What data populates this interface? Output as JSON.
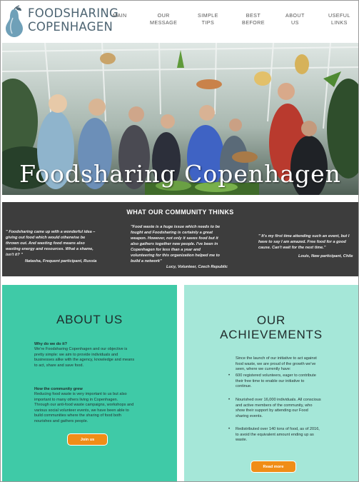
{
  "logo": {
    "line1": "FOODSHARING",
    "line2": "COPENHAGEN"
  },
  "nav": {
    "main": "MAIN",
    "our_message_1": "OUR",
    "our_message_2": "MESSAGE",
    "simple_tips_1": "SIMPLE",
    "simple_tips_2": "TIPS",
    "best_before_1": "BEST",
    "best_before_2": "BEFORE",
    "about_us_1": "ABOUT",
    "about_us_2": "US",
    "useful_links_1": "USEFUL",
    "useful_links_2": "LINKS"
  },
  "hero": {
    "title": "Foodsharing Copenhagen"
  },
  "community": {
    "title": "WHAT OUR COMMUNITY THINKS",
    "quotes": [
      {
        "lines": [
          "\" Foodsharing came up with a wonderful idea –",
          "giving out food which would otherwise be",
          "thrown out. And wasting food means also",
          "wasting energy and resources. What a shame,",
          "isn't it? \""
        ],
        "author": "Natasha, Frequent participant, Russia"
      },
      {
        "lines": [
          "\"Food waste is a huge issue which needs to be",
          "fought and Foodsharing is certainly a great",
          "weapon. However, not only it saves food but it",
          "also gathers together new people. I've been in",
          "Copenhagen for less than a year and",
          "volunteering for this organization helped me to",
          "build a network\""
        ],
        "author": "Lucy, Volunteer, Czech Republic"
      },
      {
        "lines": [
          "\" It's my first time attending such an event, but I",
          "have to say I am amazed. Free food for a good",
          "cause. Can't wait for the next time.\""
        ],
        "author": "Louis, New participant, Chile"
      }
    ]
  },
  "about": {
    "heading": "ABOUT US",
    "why_head": "Why do we do it?",
    "why_lines": [
      "We're Foodsharing Copenhagen and our objective is",
      "pretty simple: we aim to provide individuals and",
      "businesses alike with the agency, knowledge and means",
      "to act, share and save food."
    ],
    "grew_head": "How the community grew",
    "grew_lines": [
      "Reducing food waste is very important to us but also",
      "important to many others living in Copenhagen.",
      "Through our anti-food waste campaigns, workshops and",
      "various social volunteer events, we have been able to",
      "build communities where the sharing of food both",
      "nourishes and gathers people."
    ],
    "button": "Join us"
  },
  "achievements": {
    "heading_1": "OUR",
    "heading_2": "ACHIEVEMENTS",
    "intro_lines": [
      "Since the launch of our initiative to act against",
      "food waste, we are proud of the growth we've",
      "seen, where we currently have:"
    ],
    "bullets": [
      [
        "600 registered volunteers, eager to contribute",
        "their free time to enable our initiative to",
        "continue."
      ],
      [
        "Nourished over 16,000 individuals. All conscious",
        "and active members of the community, who",
        "show their support by attending our Food",
        "sharing events."
      ],
      [
        "Redistributed over 140 tons of food, as of 2016,",
        "to avoid the equivalent amount ending up as",
        "waste."
      ]
    ],
    "button": "Read more"
  },
  "colors": {
    "about_bg": "#3fcaa7",
    "achievements_bg": "#a5e7d8",
    "community_bg": "#3d3d3d",
    "button": "#f08d17",
    "logo": "#4d6472"
  }
}
